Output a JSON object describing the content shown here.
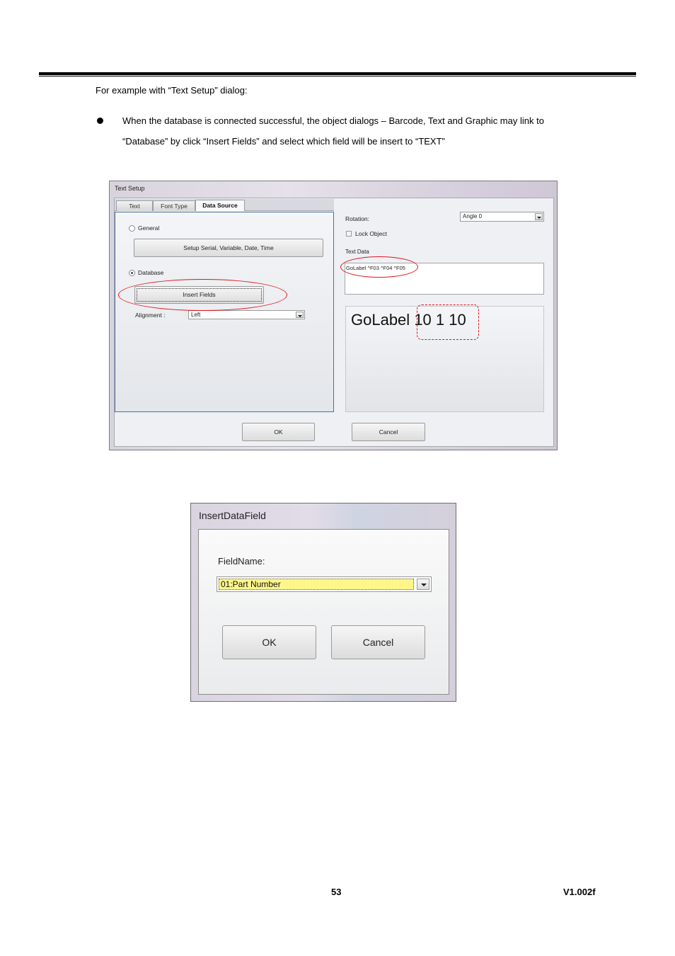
{
  "doc": {
    "intro": "For example with “Text Setup” dialog:",
    "bullet_line1": "When the database is connected successful, the object dialogs – Barcode, Text and Graphic may link to",
    "bullet_line2": "“Database” by click “Insert Fields” and select which field will be insert to “TEXT”",
    "page_number": "53",
    "version": "V1.002f"
  },
  "text_setup": {
    "title": "Text Setup",
    "tabs": [
      {
        "label": "Text"
      },
      {
        "label": "Font Type"
      },
      {
        "label": "Data Source",
        "active": true
      }
    ],
    "general_label": "General",
    "setup_button": "Setup Serial, Variable, Date, Time",
    "database_label": "Database",
    "selected_source": "Database",
    "insert_button": "Insert Fields",
    "alignment_label": "Alignment :",
    "alignment_value": "Left",
    "rotation_label": "Rotation:",
    "rotation_value": "Angle 0",
    "lock_label": "Lock Object",
    "lock_checked": false,
    "text_data_label": "Text Data",
    "text_data_value": "GoLabel ^F03 ^F04 ^F05",
    "preview_prefix": "GoLabel",
    "preview_values": "10 1 10",
    "ok_button": "OK",
    "cancel_button": "Cancel"
  },
  "insert_data_field": {
    "title": "InsertDataField",
    "field_label": "FieldName:",
    "field_value": "01:Part Number",
    "ok_button": "OK",
    "cancel_button": "Cancel"
  },
  "colors": {
    "highlight_annotation": "#e0141e",
    "selected_field_background": "#fff68a",
    "panel_border": "#4a6fa8"
  }
}
